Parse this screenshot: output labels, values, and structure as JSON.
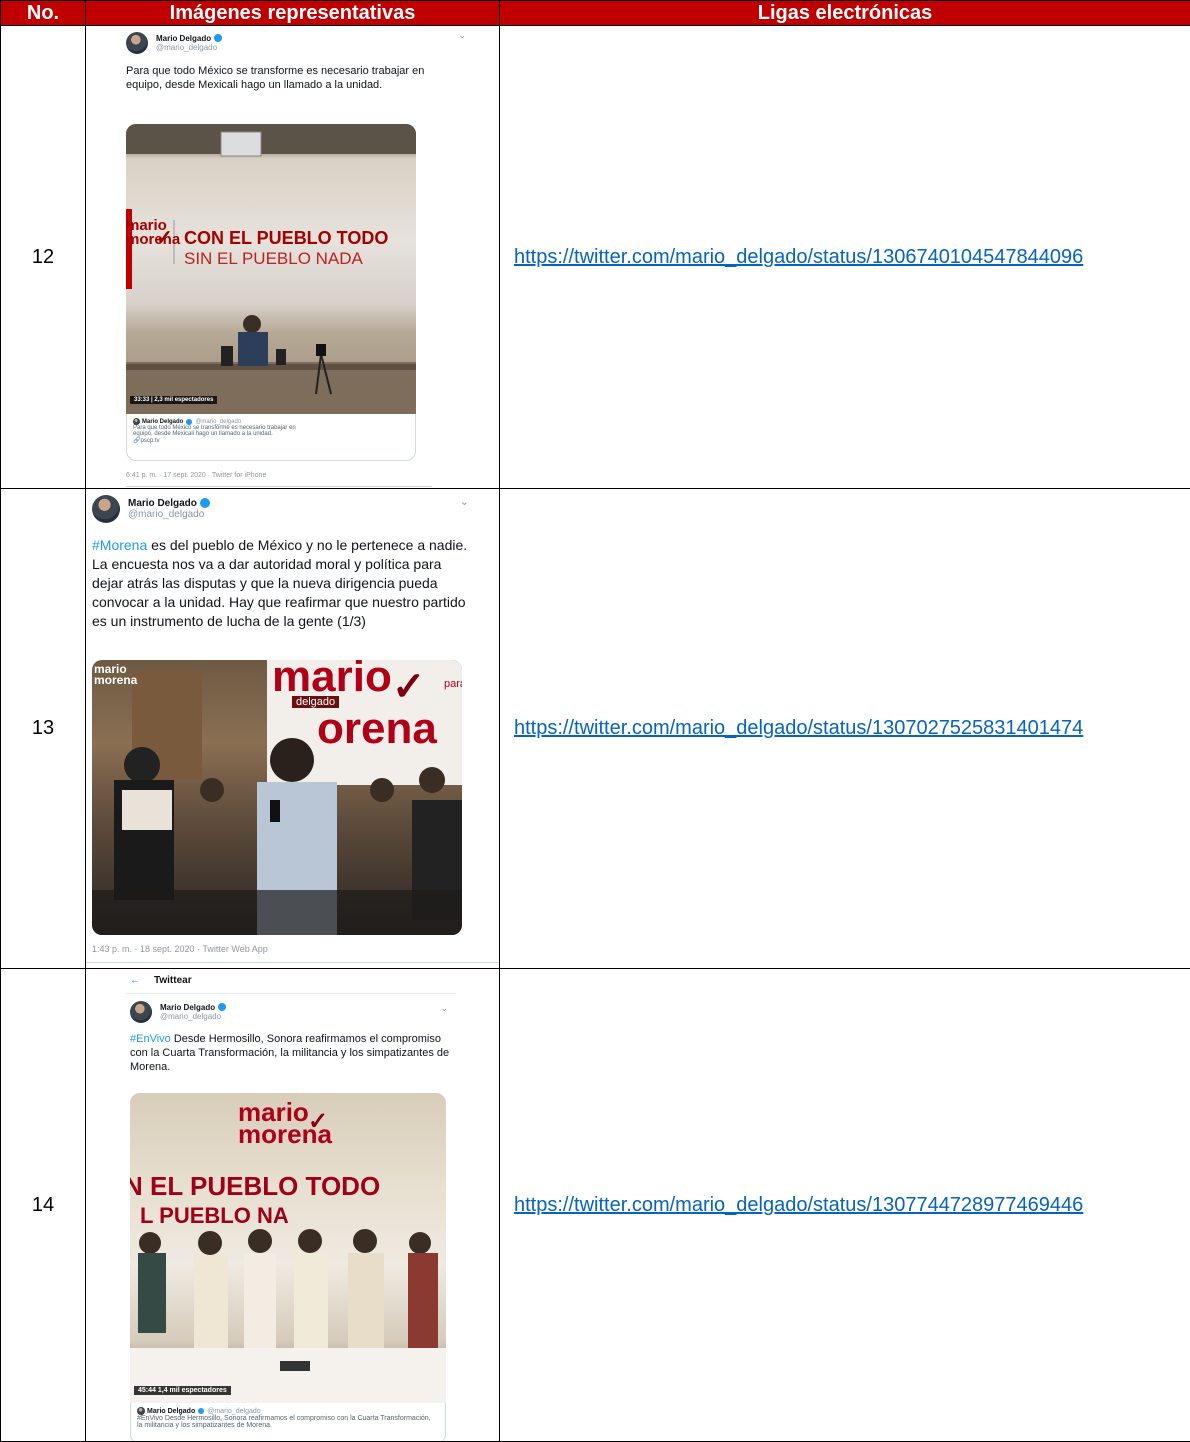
{
  "table": {
    "headers": [
      "No.",
      "Imágenes representativas",
      "Ligas electrónicas"
    ],
    "rows": [
      {
        "number": "12",
        "link": "https://twitter.com/mario_delgado/status/1306740104547844096",
        "tweet": {
          "name": "Mario Delgado",
          "handle": "@mario_delgado",
          "text": "Para que todo México se transforme es necesario trabajar en equipo, desde Mexicali hago un llamado a la unidad.",
          "banner_line1": "CON EL PUEBLO TODO",
          "banner_line2": "SIN EL PUEBLO NADA",
          "logo_top": "mario",
          "logo_bottom": "morena",
          "video_time": "33:33",
          "video_viewers": "2,3 mil espectadores",
          "card_name": "Mario Delgado",
          "card_handle": "@mario_delgado",
          "card_text": "Para que todo México se transforme es necesario trabajar en equipo, desde Mexicali hago un llamado a la unidad.",
          "card_link": "pscp.tv",
          "footer": "6:41 p. m. · 17 sept. 2020 · Twitter for iPhone"
        }
      },
      {
        "number": "13",
        "link": "https://twitter.com/mario_delgado/status/1307027525831401474",
        "tweet": {
          "name": "Mario Delgado",
          "handle": "@mario_delgado",
          "hashtag": "#Morena",
          "text": " es del pueblo de México y no le pertenece a nadie. La encuesta nos va a dar autoridad moral y política para dejar atrás las disputas y que la nueva dirigencia pueda convocar a la unidad.  Hay que reafirmar que nuestro partido es un instrumento de lucha de la gente (1/3)",
          "logo_top": "mario",
          "logo_bottom": "morena",
          "backdrop_top": "mario",
          "backdrop_bottom": "orena",
          "backdrop_small": "delgado",
          "backdrop_para": "para",
          "footer": "1:43 p. m. · 18 sept. 2020 · Twitter Web App"
        }
      },
      {
        "number": "14",
        "link": "https://twitter.com/mario_delgado/status/1307744728977469446",
        "tweet": {
          "page_title": "Twittear",
          "name": "Mario Delgado",
          "handle": "@mario_delgado",
          "hashtag": "#EnVivo",
          "text": " Desde Hermosillo, Sonora reafirmamos el compromiso con la Cuarta Transformación, la militancia y los simpatizantes de Morena.",
          "logo_top": "mario",
          "logo_bottom": "morena",
          "banner_line1": "N EL PUEBLO TODO",
          "banner_line2": "L PUEBLO NA",
          "video_time": "45:44",
          "video_viewers": "1,4 mil espectadores",
          "card_name": "Mario Delgado",
          "card_handle": "@mario_delgado",
          "card_text": "#EnVivo Desde Hermosillo, Sonora reafirmamos el compromiso con la Cuarta Transformación, la militancia y los simpatizantes de Morena."
        }
      }
    ]
  },
  "colors": {
    "header_bg": "#c00000",
    "link": "#0563c1",
    "twitter_blue": "#1d9bf0"
  }
}
